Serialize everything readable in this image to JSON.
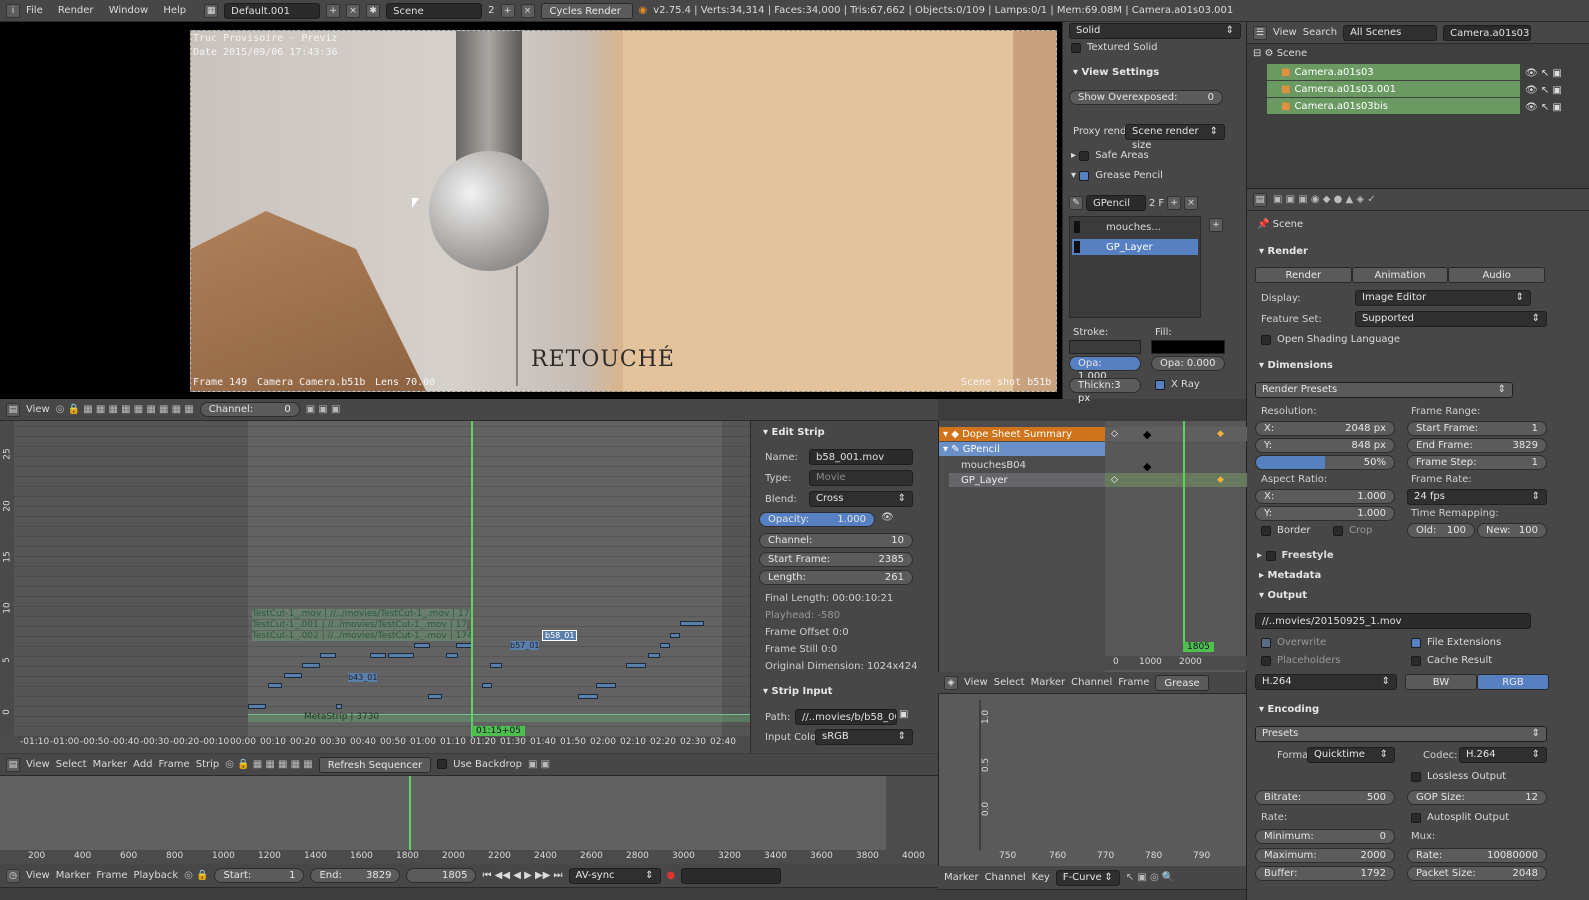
{
  "topbar": {
    "menus": [
      "File",
      "Render",
      "Window",
      "Help"
    ],
    "layout": "Default.001",
    "scene": "Scene",
    "scene_count": "2",
    "engine": "Cycles Render",
    "stats": "v2.75.4 | Verts:34,314 | Faces:34,000 | Tris:67,662 | Objects:0/109 | Lamps:0/1 | Mem:69.08M | Camera.a01s03.001"
  },
  "viewport": {
    "stamp_line1": "Truc Provisoire - Previz",
    "stamp_line2": "Date 2015/09/06 17:43:36",
    "footer_frame": "Frame 149",
    "footer_camera": "Camera Camera.b51b",
    "footer_lens": "Lens 70.00",
    "footer_right": "Scene shot b51b",
    "annotation": "RETOUCHÉ"
  },
  "viewprops": {
    "shading_solid": "Solid",
    "textured_solid": "Textured Solid",
    "view_settings": "View Settings",
    "show_overexposed": "Show Overexposed:",
    "show_overexposed_val": "0",
    "proxy_label": "Proxy rend",
    "proxy_value": "Scene render size",
    "safe_areas": "Safe Areas",
    "grease_pencil": "Grease Pencil",
    "gp_name": "GPencil",
    "gp_users": "2",
    "gp_f": "F",
    "layers": [
      "mouches...",
      "GP_Layer"
    ],
    "stroke": "Stroke:",
    "fill": "Fill:",
    "stroke_opa": "Opa: 1.000",
    "fill_opa": "Opa: 0.000",
    "thickness": "Thickn:3 px",
    "xray": "X Ray"
  },
  "outliner": {
    "menus": [
      "View",
      "Search"
    ],
    "filter": "All Scenes",
    "active": "Camera.a01s03",
    "root": "Scene",
    "items": [
      "Camera.a01s03",
      "Camera.a01s03.001",
      "Camera.a01s03bis"
    ]
  },
  "properties": {
    "context": "Scene",
    "render_title": "Render",
    "render_btn": "Render",
    "animation_btn": "Animation",
    "audio_btn": "Audio",
    "display_label": "Display:",
    "display_val": "Image Editor",
    "feature_label": "Feature Set:",
    "feature_val": "Supported",
    "osl": "Open Shading Language",
    "dimensions": "Dimensions",
    "render_presets": "Render Presets",
    "resolution": "Resolution:",
    "res_x_label": "X:",
    "res_x": "2048 px",
    "res_y_label": "Y:",
    "res_y": "848 px",
    "res_pct": "50%",
    "aspect": "Aspect Ratio:",
    "asp_x_label": "X:",
    "asp_x": "1.000",
    "asp_y_label": "Y:",
    "asp_y": "1.000",
    "border": "Border",
    "crop": "Crop",
    "frame_range": "Frame Range:",
    "start_frame_label": "Start Frame:",
    "start_frame": "1",
    "end_frame_label": "End Frame:",
    "end_frame": "3829",
    "frame_step_label": "Frame Step:",
    "frame_step": "1",
    "frame_rate": "Frame Rate:",
    "fps": "24 fps",
    "time_remap": "Time Remapping:",
    "old_label": "Old:",
    "old": "100",
    "new_label": "New:",
    "new": "100",
    "freestyle": "Freestyle",
    "metadata": "Metadata",
    "output": "Output",
    "output_path": "//..movies/20150925_1.mov",
    "overwrite": "Overwrite",
    "file_ext": "File Extensions",
    "placeholders": "Placeholders",
    "cache_result": "Cache Result",
    "codec_sel": "H.264",
    "bw": "BW",
    "rgb": "RGB",
    "encoding": "Encoding",
    "presets": "Presets",
    "format_label": "Format:",
    "format": "Quicktime",
    "codec_label": "Codec:",
    "codec": "H.264",
    "lossless": "Lossless Output",
    "bitrate_label": "Bitrate:",
    "bitrate": "500",
    "gop_label": "GOP Size:",
    "gop": "12",
    "autosplit": "Autosplit Output",
    "rate_label": "Rate:",
    "mux_label": "Mux:",
    "min_label": "Minimum:",
    "min": "0",
    "max_label": "Maximum:",
    "max": "2000",
    "mux_rate_label": "Rate:",
    "mux_rate": "10080000",
    "buffer_label": "Buffer:",
    "buffer": "1792",
    "packet_label": "Packet Size:",
    "packet": "2048"
  },
  "sequencer": {
    "view_menu": "View",
    "channel_label": "Channel:",
    "channel_val": "0",
    "y_ticks": [
      "25",
      "20",
      "15",
      "10",
      "5",
      "0"
    ],
    "time_ticks": [
      "-01:10",
      "-01:00",
      "-00:50",
      "-00:40",
      "-00:30",
      "-00:20",
      "-00:10",
      "00:00",
      "00:10",
      "00:20",
      "00:30",
      "00:40",
      "00:50",
      "01:00",
      "01:10",
      "01:20",
      "01:30",
      "01:40",
      "01:50",
      "02:00",
      "02:10",
      "02:20",
      "02:30",
      "02:40"
    ],
    "current_time": "01:15+05",
    "strip_labels": [
      "TestCut-1_.mov | //../movies/TestCut-1_.mov | 17",
      "TestCut-1_.001 | //../movies/TestCut-1_.mov | 17",
      "TestCut-1_.002 | //../movies/TestCut-1_.mov | 174"
    ],
    "b58_label": "b58_01",
    "b57_label": "b57_01",
    "b43_label": "b43_01",
    "meta_label": "MetaStrip | 3730"
  },
  "strip": {
    "edit_strip": "Edit Strip",
    "name_label": "Name:",
    "name": "b58_001.mov",
    "type_label": "Type:",
    "type": "Movie",
    "blend_label": "Blend:",
    "blend": "Cross",
    "opacity_label": "Opacity:",
    "opacity": "1.000",
    "channel_label": "Channel:",
    "channel": "10",
    "start_label": "Start Frame:",
    "start": "2385",
    "length_label": "Length:",
    "length": "261",
    "final_length": "Final Length: 00:00:10:21",
    "playhead": "Playhead: -580",
    "frame_offset": "Frame Offset 0:0",
    "frame_still": "Frame Still 0:0",
    "orig_dim": "Original Dimension: 1024x424",
    "strip_input": "Strip Input",
    "path_label": "Path:",
    "path": "//..movies/b/b58_00...",
    "input_color_label": "Input Colo",
    "input_color": "sRGB"
  },
  "seqheader": {
    "menus": [
      "View",
      "Select",
      "Marker",
      "Add",
      "Frame",
      "Strip"
    ],
    "refresh": "Refresh Sequencer",
    "use_backdrop": "Use Backdrop"
  },
  "minitimeline": {
    "ticks": [
      "200",
      "400",
      "600",
      "800",
      "1000",
      "1200",
      "1400",
      "1600",
      "1800",
      "2000",
      "2200",
      "2400",
      "2600",
      "2800",
      "3000",
      "3200",
      "3400",
      "3600",
      "3800",
      "4000"
    ]
  },
  "playback": {
    "menus": [
      "View",
      "Marker",
      "Frame",
      "Playback"
    ],
    "start_label": "Start:",
    "start": "1",
    "end_label": "End:",
    "end": "3829",
    "current": "1805",
    "sync": "AV-sync"
  },
  "dopesheet": {
    "summary": "Dope Sheet Summary",
    "gpencil": "GPencil",
    "layer1": "mouchesB04",
    "layer2": "GP_Layer",
    "frame_label": "1805",
    "ticks": [
      "0",
      "1000",
      "2000"
    ],
    "menus": [
      "View",
      "Select",
      "Marker",
      "Channel",
      "Frame"
    ],
    "mode": "Grease"
  },
  "graph": {
    "y_ticks": [
      "1.0",
      "0.5",
      "0.0"
    ],
    "x_ticks": [
      "750",
      "760",
      "770",
      "780",
      "790"
    ],
    "menus": [
      "Marker",
      "Channel",
      "Key"
    ],
    "mode": "F-Curve"
  }
}
